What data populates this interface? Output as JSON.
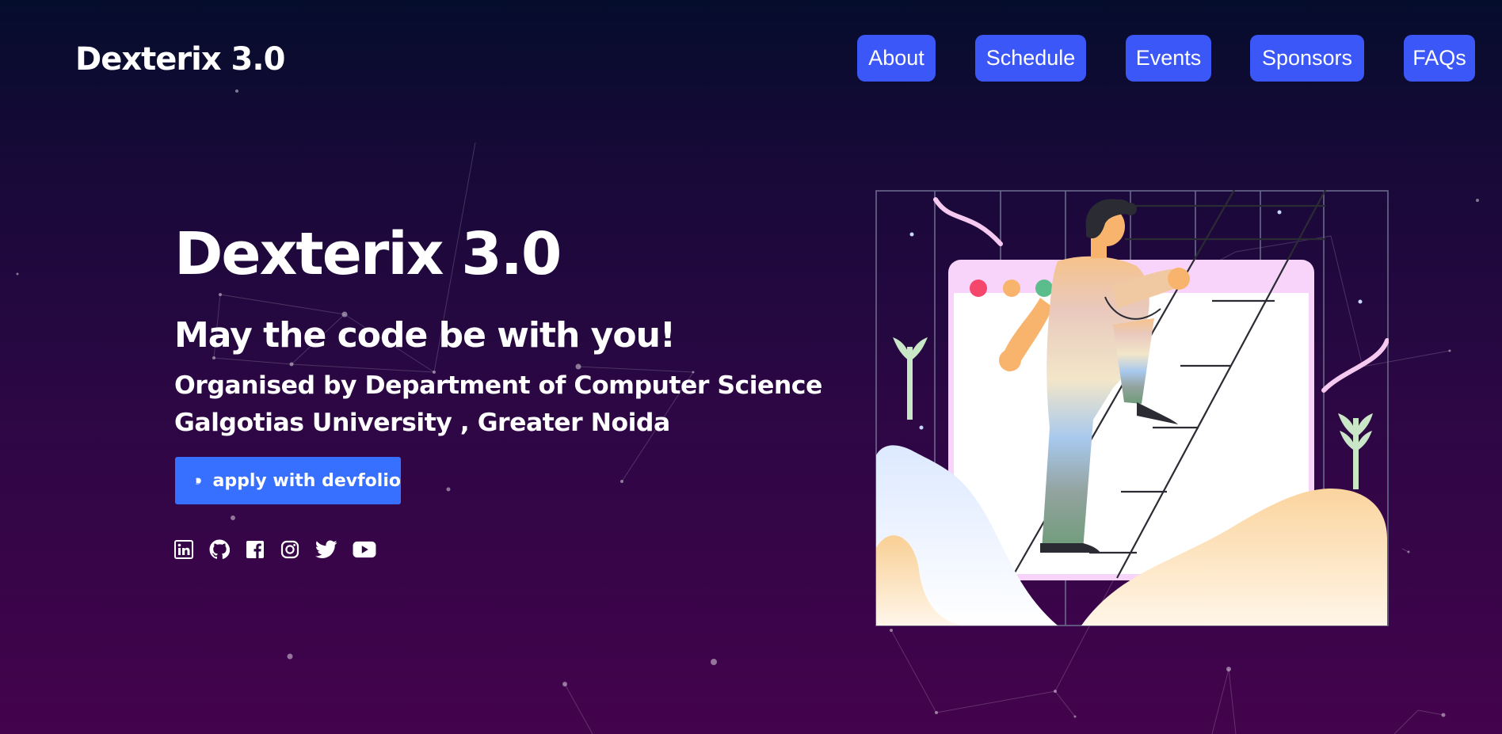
{
  "brand": {
    "logo_text": "Dexterix 3.0"
  },
  "nav": {
    "items": [
      {
        "label": "About"
      },
      {
        "label": "Schedule"
      },
      {
        "label": "Events"
      },
      {
        "label": "Sponsors"
      },
      {
        "label": "FAQs"
      }
    ]
  },
  "hero": {
    "title": "Dexterix 3.0",
    "tagline": "May the code be with you!",
    "org_line1": "Organised by Department of Computer Science",
    "org_line2": "Galgotias University , Greater Noida",
    "apply_button_label": "apply with devfolio"
  },
  "socials": [
    {
      "icon": "linkedin-icon"
    },
    {
      "icon": "github-icon"
    },
    {
      "icon": "facebook-icon"
    },
    {
      "icon": "instagram-icon"
    },
    {
      "icon": "twitter-icon"
    },
    {
      "icon": "youtube-icon"
    }
  ],
  "colors": {
    "nav_button": "#3c57f7",
    "apply_button": "#3770ff",
    "background_top": "#050d2c",
    "background_bottom": "#44034d",
    "text": "#ffffff"
  }
}
